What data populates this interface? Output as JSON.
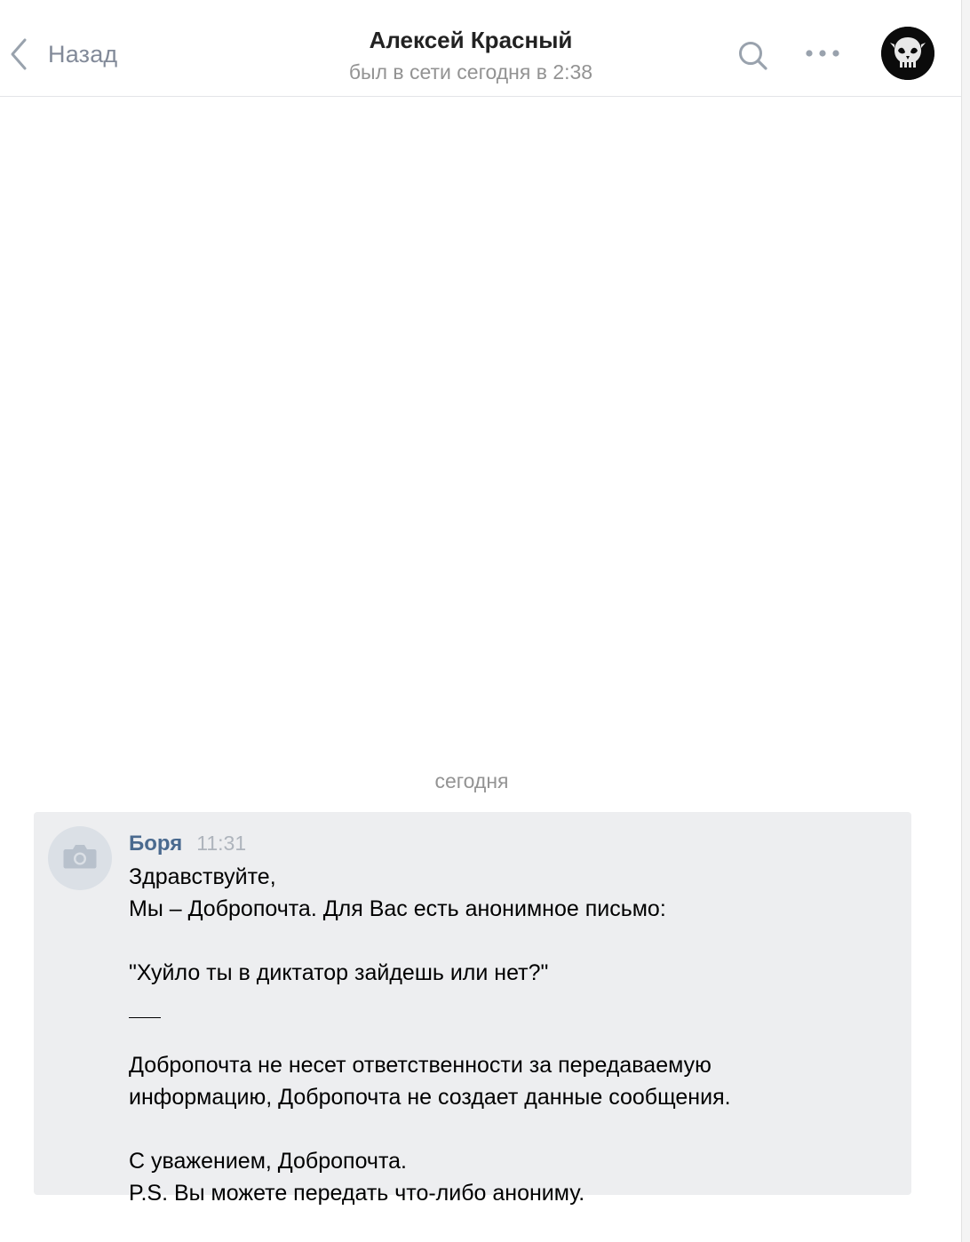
{
  "header": {
    "back_label": "Назад",
    "contact_name": "Алексей Красный",
    "status": "был в сети сегодня в 2:38",
    "icons": [
      "chevron-left-icon",
      "search-icon",
      "more-icon",
      "avatar"
    ]
  },
  "date_divider": "сегодня",
  "message": {
    "author": "Боря",
    "time": "11:31",
    "avatar_icon": "camera-icon",
    "lines": [
      "Здравствуйте,",
      "Мы – Добропочта. Для Вас есть анонимное письмо:",
      "",
      "\"Хуйло ты в диктатор зайдешь или нет?\"",
      "",
      "Добропочта не несет ответственности за передаваемую",
      "информацию, Добропочта не создает данные сообщения.",
      "",
      "С уважением, Добропочта.",
      "P.S. Вы можете передать что-либо анониму."
    ]
  },
  "colors": {
    "accent_link": "#4a6a8f",
    "muted_text": "#939393",
    "message_bg": "#edeef0"
  }
}
